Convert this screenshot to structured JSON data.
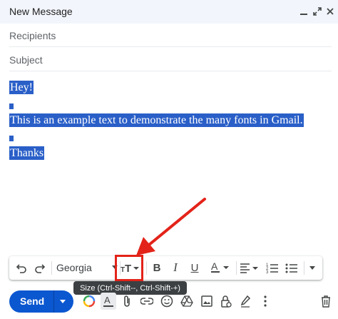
{
  "window": {
    "title": "New Message",
    "controls": [
      "minimize-icon",
      "pop-out-icon",
      "close-icon"
    ]
  },
  "fields": {
    "recipients_placeholder": "Recipients",
    "subject_placeholder": "Subject"
  },
  "body": {
    "lines": [
      "Hey!",
      "This is an example text to demonstrate the many fonts in Gmail.",
      "Thanks"
    ]
  },
  "toolbar": {
    "font_name": "Georgia",
    "buttons": [
      "undo-icon",
      "redo-icon",
      "font-size-icon",
      "bold-icon",
      "italic-icon",
      "underline-icon",
      "text-color-icon",
      "align-icon",
      "numbered-list-icon",
      "bulleted-list-icon",
      "more-formatting-icon"
    ],
    "tooltip": "Size (Ctrl-Shift--, Ctrl-Shift-+)"
  },
  "footer": {
    "send_label": "Send",
    "icons": [
      "ai-assist-icon",
      "formatting-options-icon",
      "attach-icon",
      "link-icon",
      "emoji-icon",
      "drive-icon",
      "photo-icon",
      "confidential-icon",
      "signature-icon",
      "more-options-icon",
      "discard-icon"
    ]
  },
  "colors": {
    "selection": "#2a5fc8",
    "annotation": "#e32319",
    "send_button": "#0b57d0",
    "header_bg": "#f2f6fc"
  }
}
